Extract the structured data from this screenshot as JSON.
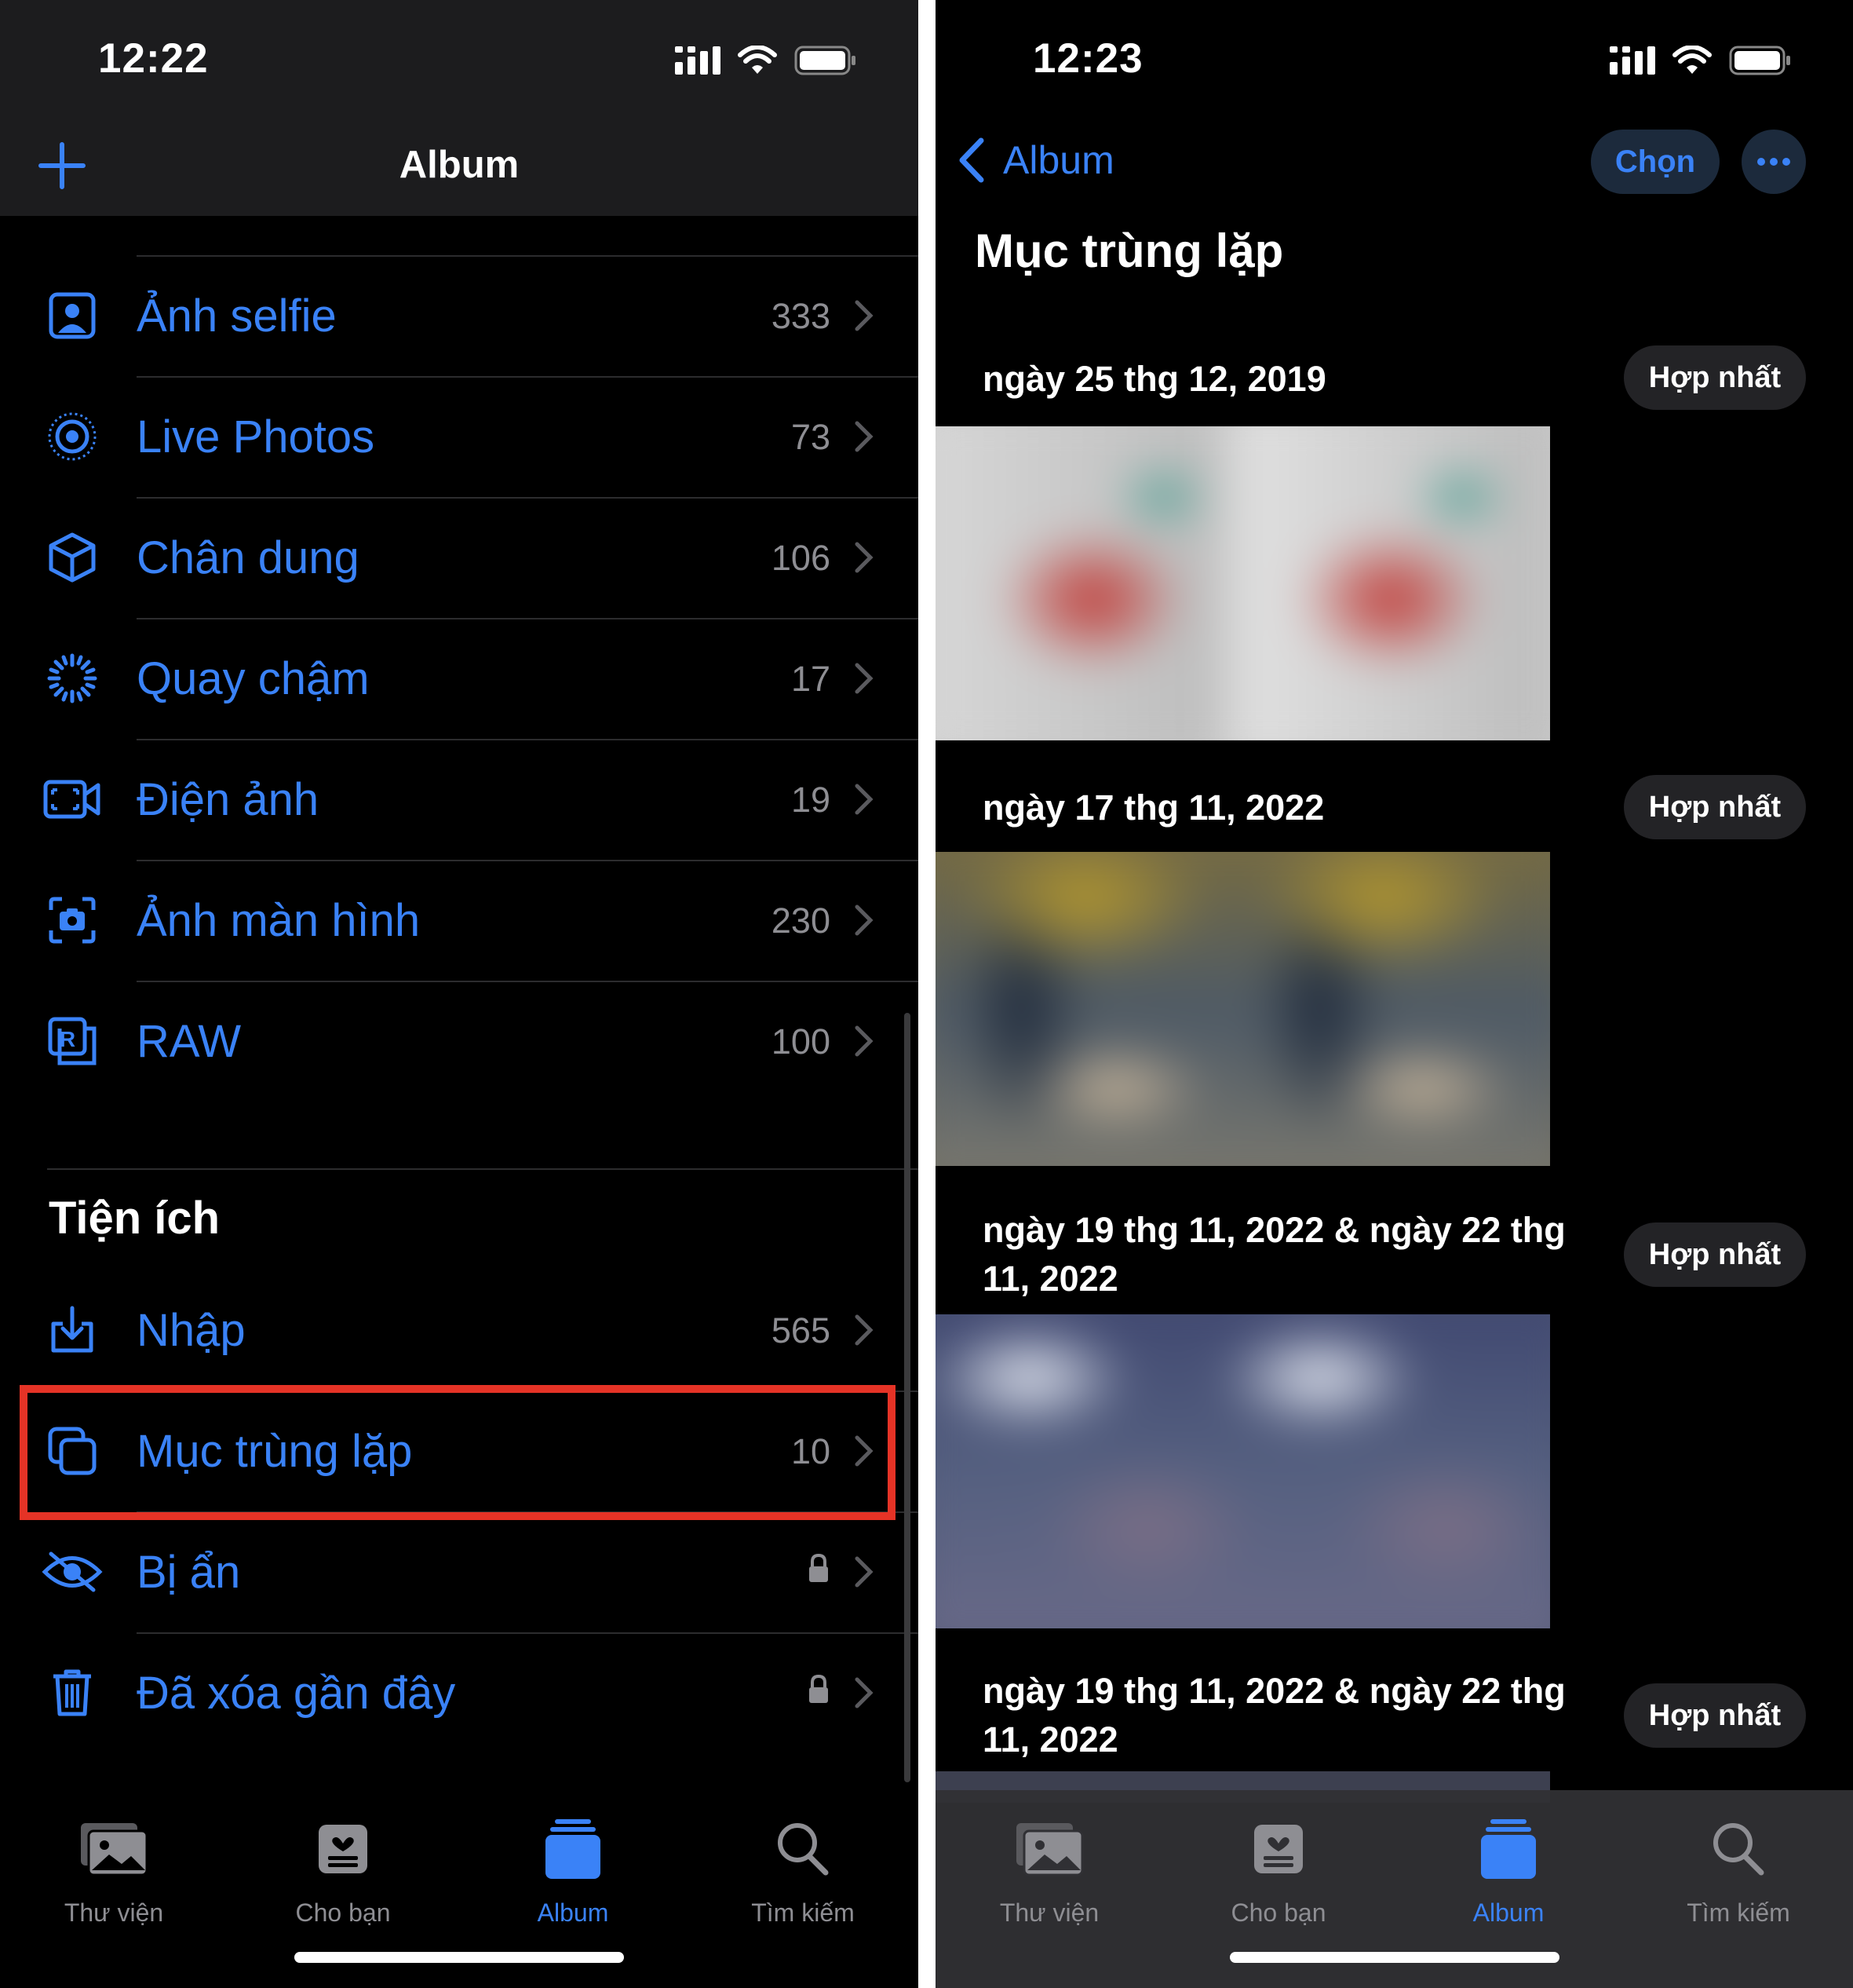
{
  "left": {
    "status": {
      "time": "12:22"
    },
    "nav": {
      "title": "Album"
    },
    "media_types": [
      {
        "label": "Ảnh selfie",
        "count": "333",
        "icon": "selfie-icon"
      },
      {
        "label": "Live Photos",
        "count": "73",
        "icon": "live-photos-icon"
      },
      {
        "label": "Chân dung",
        "count": "106",
        "icon": "portrait-cube-icon"
      },
      {
        "label": "Quay chậm",
        "count": "17",
        "icon": "slow-motion-icon"
      },
      {
        "label": "Điện ảnh",
        "count": "19",
        "icon": "cinematic-icon"
      },
      {
        "label": "Ảnh màn hình",
        "count": "230",
        "icon": "screenshot-icon"
      },
      {
        "label": "RAW",
        "count": "100",
        "icon": "raw-icon"
      }
    ],
    "utilities": {
      "title": "Tiện ích",
      "items": [
        {
          "label": "Nhập",
          "count": "565",
          "icon": "import-icon"
        },
        {
          "label": "Mục trùng lặp",
          "count": "10",
          "icon": "duplicates-icon"
        },
        {
          "label": "Bị ẩn",
          "icon": "hidden-eye-icon",
          "locked": true
        },
        {
          "label": "Đã xóa gần đây",
          "icon": "trash-icon",
          "locked": true
        }
      ]
    },
    "highlight_color": "#e53326"
  },
  "right": {
    "status": {
      "time": "12:23"
    },
    "nav": {
      "back_label": "Album",
      "select_label": "Chọn"
    },
    "title": "Mục trùng lặp",
    "groups": [
      {
        "date": "ngày 25 thg 12, 2019",
        "merge_label": "Hợp nhất"
      },
      {
        "date": "ngày 17 thg 11, 2022",
        "merge_label": "Hợp nhất"
      },
      {
        "date": "ngày 19 thg 11, 2022 & ngày 22 thg 11, 2022",
        "merge_label": "Hợp nhất"
      },
      {
        "date": "ngày 19 thg 11, 2022 & ngày 22 thg 11, 2022",
        "merge_label": "Hợp nhất"
      }
    ]
  },
  "tabs": [
    {
      "label": "Thư viện",
      "icon": "library-icon"
    },
    {
      "label": "Cho bạn",
      "icon": "for-you-icon"
    },
    {
      "label": "Album",
      "icon": "albums-icon",
      "active": true
    },
    {
      "label": "Tìm kiếm",
      "icon": "search-icon"
    }
  ],
  "colors": {
    "accent": "#3a82f7",
    "secondary_text": "#8e8e93",
    "background": "#000000"
  }
}
